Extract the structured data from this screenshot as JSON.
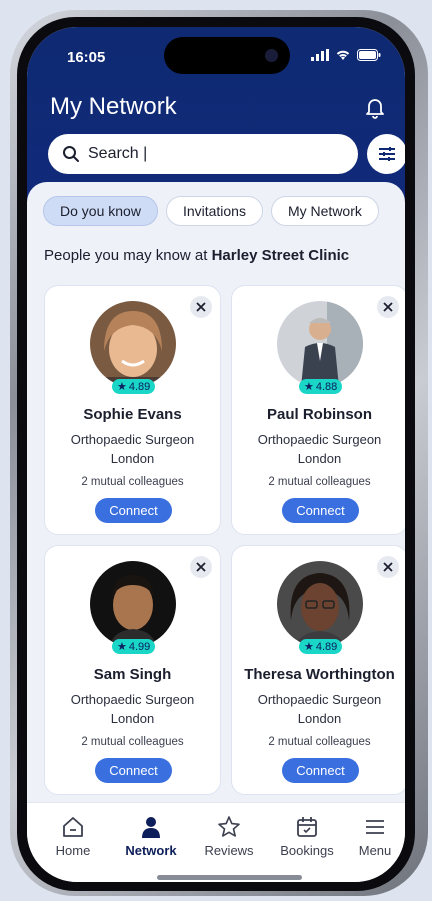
{
  "status_bar": {
    "time": "16:05"
  },
  "header": {
    "title": "My Network"
  },
  "search": {
    "text": "Search |"
  },
  "tabs": [
    {
      "label": "Do you know",
      "active": true
    },
    {
      "label": "Invitations",
      "active": false
    },
    {
      "label": "My Network",
      "active": false
    }
  ],
  "section": {
    "prefix": "People you may know at ",
    "clinic": "Harley Street Clinic"
  },
  "cards": [
    {
      "name": "Sophie Evans",
      "role": "Orthopaedic Surgeon",
      "location": "London",
      "rating": "4.89",
      "mutual": "2 mutual colleagues",
      "connect": "Connect"
    },
    {
      "name": "Paul Robinson",
      "role": "Orthopaedic Surgeon",
      "location": "London",
      "rating": "4.88",
      "mutual": "2 mutual colleagues",
      "connect": "Connect"
    },
    {
      "name": "Sam Singh",
      "role": "Orthopaedic Surgeon",
      "location": "London",
      "rating": "4.99",
      "mutual": "2 mutual colleagues",
      "connect": "Connect"
    },
    {
      "name": "Theresa Worthington",
      "role": "Orthopaedic Surgeon",
      "location": "London",
      "rating": "4.89",
      "mutual": "2 mutual colleagues",
      "connect": "Connect"
    }
  ],
  "nav": [
    {
      "label": "Home",
      "icon": "home-icon"
    },
    {
      "label": "Network",
      "icon": "person-icon",
      "active": true
    },
    {
      "label": "Reviews",
      "icon": "star-icon"
    },
    {
      "label": "Bookings",
      "icon": "calendar-icon"
    },
    {
      "label": "Menu",
      "icon": "menu-icon"
    }
  ],
  "colors": {
    "header": "#10297a",
    "accent": "#3a6fe0",
    "rating": "#19d6c6"
  }
}
